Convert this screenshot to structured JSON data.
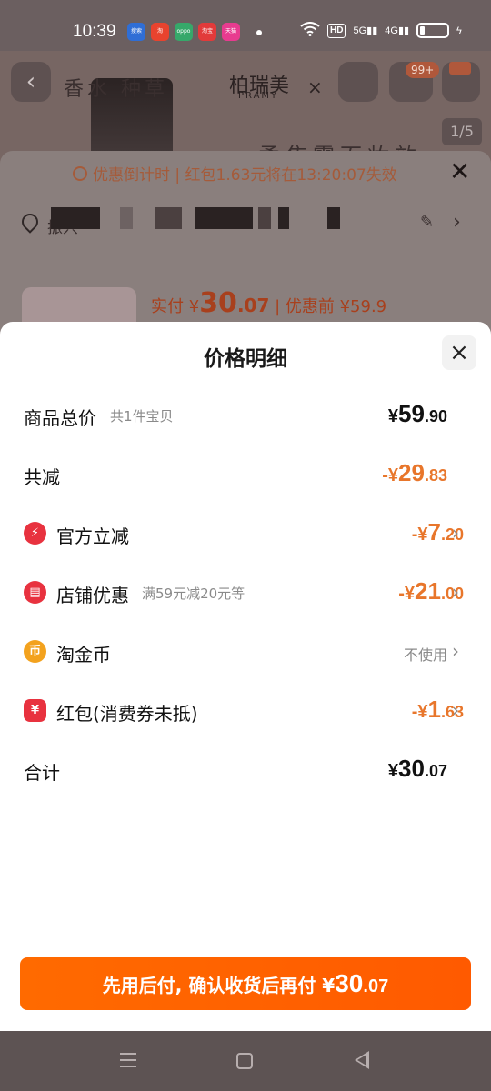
{
  "statusbar": {
    "time": "10:39",
    "apps": [
      {
        "name": "app-icon-1",
        "color": "#2f6ed6",
        "text": "搜索"
      },
      {
        "name": "app-icon-2",
        "color": "#e8432e",
        "text": "淘"
      },
      {
        "name": "app-icon-3",
        "color": "#36a86a",
        "text": "oppo"
      },
      {
        "name": "app-icon-4",
        "color": "#e23a3a",
        "text": "淘宝"
      },
      {
        "name": "app-icon-5",
        "color": "#e83b8f",
        "text": "天猫"
      }
    ],
    "hd": "HD",
    "net1": "5G",
    "net2": "4G"
  },
  "background": {
    "category": "香水 种草",
    "brand": "柏瑞美",
    "brand_sub": "PRAMY",
    "x_mark": "×",
    "cart_badge": "99+",
    "pager": "1/5",
    "title": "柔焦雾面妆效"
  },
  "order_sheet": {
    "countdown": "优惠倒计时 | 红包1.63元将在13:20:07失效",
    "addr_prefix": "振兴",
    "actual_prefix": "实付 ¥",
    "actual_int": "30",
    "actual_dec": ".07",
    "before_label": " | 优惠前 ¥59.9"
  },
  "detail": {
    "title": "价格明细",
    "close": "×",
    "rows": [
      {
        "label": "商品总价",
        "sub": "共1件宝贝",
        "cur": "¥",
        "int": "59",
        "dec": ".90"
      },
      {
        "label": "共减",
        "cur": "-¥",
        "int": "29",
        "dec": ".83"
      },
      {
        "label": "官方立减",
        "cur": "-¥",
        "int": "7",
        "dec": ".20"
      },
      {
        "label": "店铺优惠",
        "sub": "满59元减20元等",
        "cur": "-¥",
        "int": "21",
        "dec": ".00"
      },
      {
        "label": "淘金币",
        "plain": "不使用"
      },
      {
        "label": "红包(消费券未抵)",
        "cur": "-¥",
        "int": "1",
        "dec": ".63"
      },
      {
        "label": "合计",
        "cur": "¥",
        "int": "30",
        "dec": ".07"
      }
    ],
    "icons": {
      "official": {
        "glyph": "⚡",
        "color": "#e8323f"
      },
      "shop": {
        "glyph": "▤",
        "color": "#e8323f"
      },
      "coin": {
        "glyph": "币",
        "color": "#f3a21e"
      },
      "redpacket": {
        "glyph": "¥",
        "color": "#e8323f"
      }
    }
  },
  "pay_button": {
    "text": "先用后付, 确认收货后再付 ¥",
    "int": "30",
    "dec": ".07"
  },
  "colors": {
    "accent_orange": "#e8762b",
    "button_orange": "#ff6000"
  }
}
